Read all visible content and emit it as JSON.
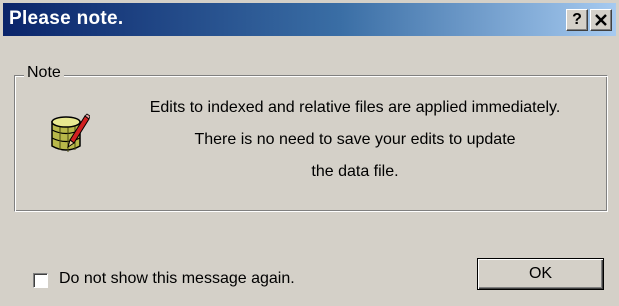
{
  "window": {
    "title": "Please note.",
    "help_label": "?",
    "close_label": "×"
  },
  "group": {
    "legend": "Note",
    "icon": "database-edit-icon",
    "message_lines": [
      "Edits to indexed and relative files are applied immediately.",
      "There is no need to save your edits to update",
      "the data file."
    ]
  },
  "footer": {
    "checkbox_label": "Do not show this message again.",
    "checkbox_checked": false,
    "ok_label": "OK"
  },
  "colors": {
    "title_gradient_start": "#0a246a",
    "title_gradient_end": "#a6caf0",
    "face": "#d4d0c8"
  }
}
